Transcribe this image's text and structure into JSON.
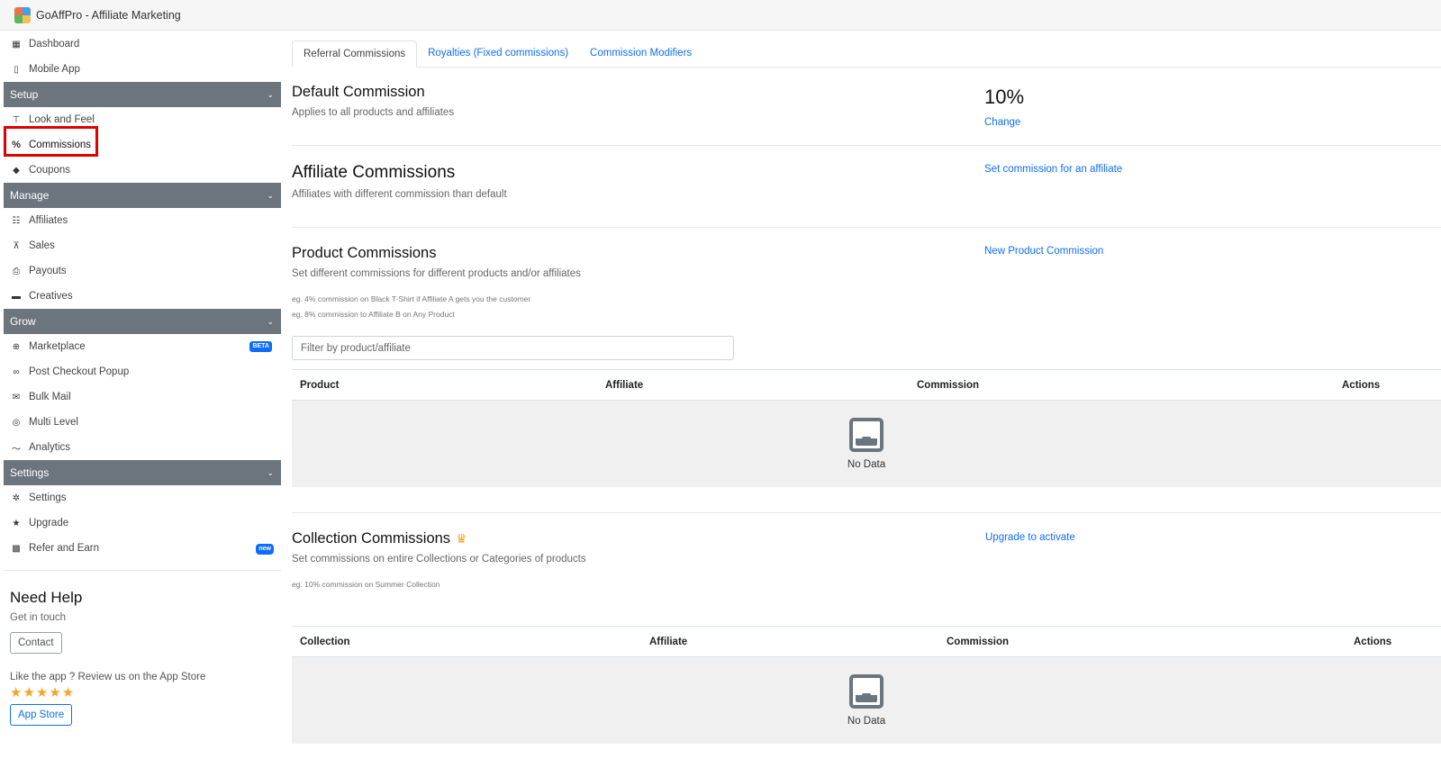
{
  "app": {
    "title": "GoAffPro - Affiliate Marketing"
  },
  "sidebar": {
    "top": [
      {
        "label": "Dashboard",
        "icon": "dashboard-icon"
      },
      {
        "label": "Mobile App",
        "icon": "mobile-icon"
      }
    ],
    "sections": {
      "setup": {
        "label": "Setup",
        "items": [
          "Look and Feel",
          "Commissions",
          "Coupons"
        ]
      },
      "manage": {
        "label": "Manage",
        "items": [
          "Affiliates",
          "Sales",
          "Payouts",
          "Creatives"
        ]
      },
      "grow": {
        "label": "Grow",
        "items": [
          "Marketplace",
          "Post Checkout Popup",
          "Bulk Mail",
          "Multi Level",
          "Analytics"
        ],
        "marketplace_badge": "BETA"
      },
      "settings": {
        "label": "Settings",
        "items": [
          "Settings",
          "Upgrade",
          "Refer and Earn"
        ],
        "refer_badge": "new"
      }
    },
    "active_item": "Commissions",
    "help": {
      "title": "Need Help",
      "subtitle": "Get in touch",
      "contact_label": "Contact",
      "review_text": "Like the app ? Review us on the App Store",
      "stars": "★★★★★",
      "app_store_label": "App Store"
    }
  },
  "tabs": [
    "Referral Commissions",
    "Royalties (Fixed commissions)",
    "Commission Modifiers"
  ],
  "default_commission": {
    "title": "Default Commission",
    "desc": "Applies to all products and affiliates",
    "value": "10%",
    "change_label": "Change"
  },
  "affiliate_commissions": {
    "title": "Affiliate Commissions",
    "desc": "Affiliates with different commission than default",
    "link": "Set commission for an affiliate"
  },
  "product_commissions": {
    "title": "Product Commissions",
    "desc": "Set different commissions for different products and/or affiliates",
    "example1": "eg. 4% commission on Black T-Shirt if Affiliate A gets you the customer",
    "example2": "eg. 8% commission to Affiliate B on Any Product",
    "link": "New Product Commission",
    "filter_placeholder": "Filter by product/affiliate",
    "columns": [
      "Product",
      "Affiliate",
      "Commission",
      "Actions"
    ],
    "empty": "No Data"
  },
  "collection_commissions": {
    "title": "Collection Commissions",
    "desc": "Set commissions on entire Collections or Categories of products",
    "example": "eg. 10% commission on Summer Collection",
    "link": "Upgrade to activate",
    "columns": [
      "Collection",
      "Affiliate",
      "Commission",
      "Actions"
    ],
    "empty": "No Data"
  }
}
